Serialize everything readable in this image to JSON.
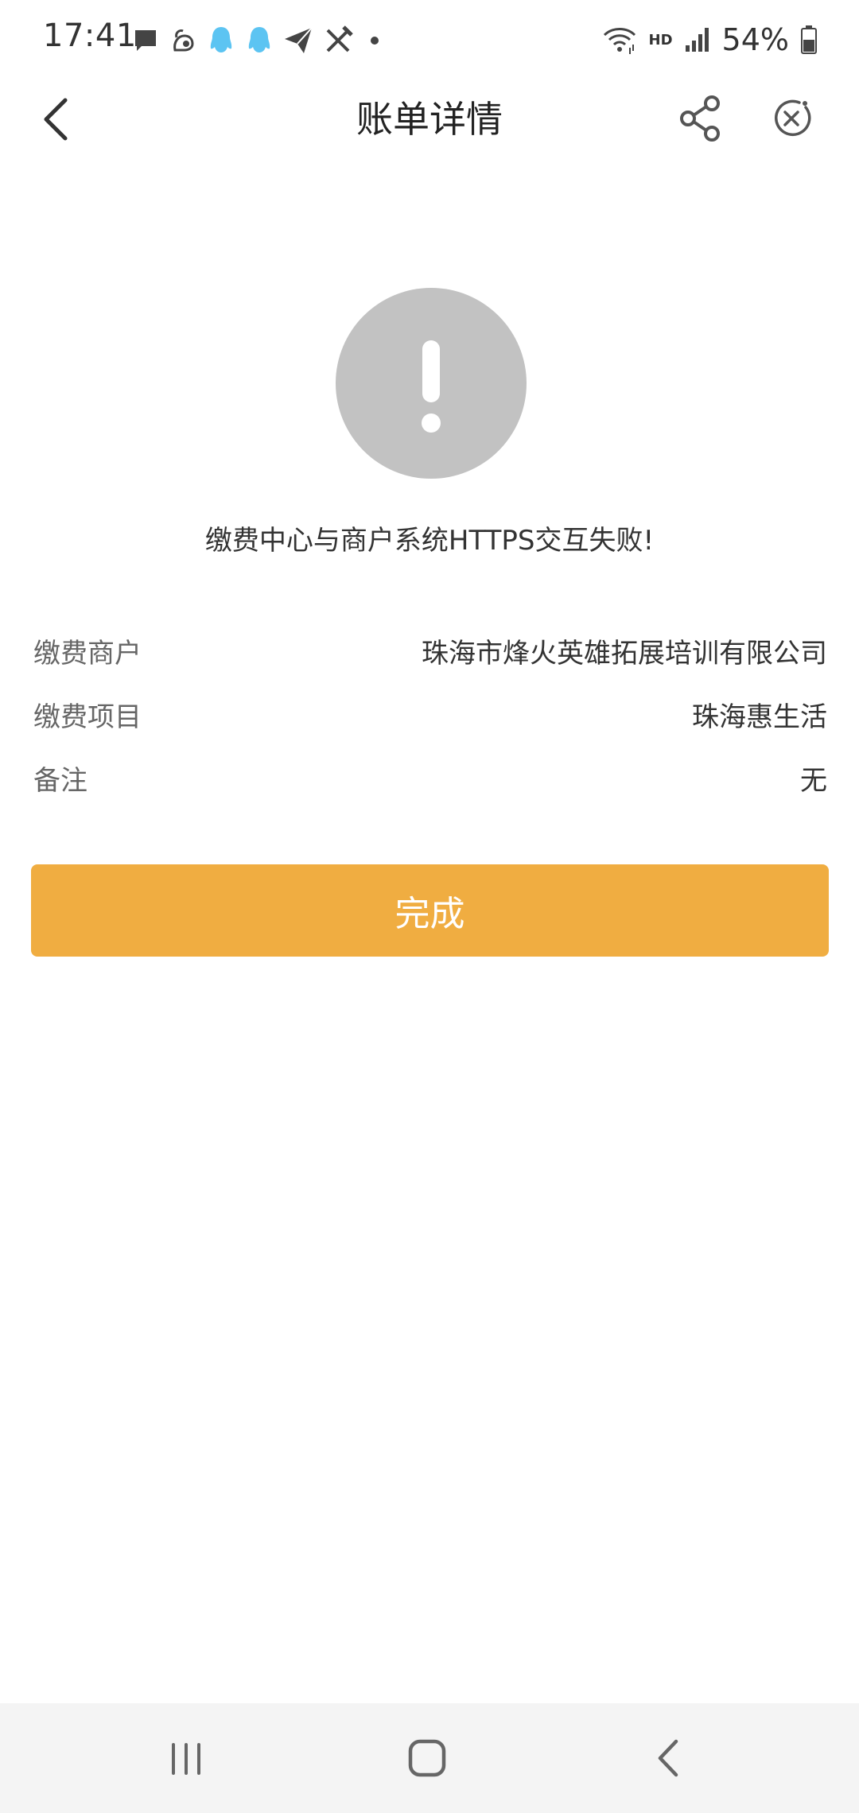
{
  "status_bar": {
    "time": "17:41",
    "network_label": "HD",
    "battery": "54%",
    "notification_icons": [
      "message-icon",
      "squirrel-app-icon",
      "qq-icon",
      "qq-icon",
      "paper-plane-icon",
      "crossed-tools-icon",
      "dot-icon"
    ]
  },
  "nav": {
    "title": "账单详情"
  },
  "result": {
    "status": "error",
    "message": "缴费中心与商户系统HTTPS交互失败!"
  },
  "details": [
    {
      "label": "缴费商户",
      "value": "珠海市烽火英雄拓展培训有限公司"
    },
    {
      "label": "缴费项目",
      "value": "珠海惠生活"
    },
    {
      "label": "备注",
      "value": "无"
    }
  ],
  "actions": {
    "done_label": "完成"
  },
  "colors": {
    "primary_button": "#f0ad41",
    "result_icon": "#c2c2c2",
    "qq_icon": "#5cc4f2"
  }
}
